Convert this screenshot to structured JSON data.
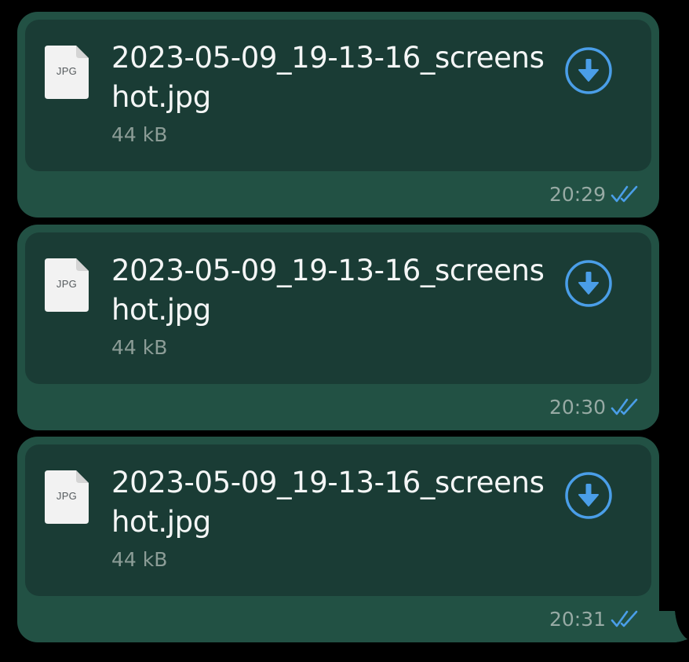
{
  "colors": {
    "bubble": "#225144",
    "card": "#1a3c35",
    "accent": "#4a9ee8",
    "text": "#f4f6f6",
    "muted": "#8c9d97"
  },
  "messages": [
    {
      "file_ext": "JPG",
      "file_name": "2023-05-09_19-13-16_screenshot.jpg",
      "file_size": "44 kB",
      "time": "20:29",
      "status_icon": "double-check-icon",
      "action_icon": "download-icon"
    },
    {
      "file_ext": "JPG",
      "file_name": "2023-05-09_19-13-16_screenshot.jpg",
      "file_size": "44 kB",
      "time": "20:30",
      "status_icon": "double-check-icon",
      "action_icon": "download-icon"
    },
    {
      "file_ext": "JPG",
      "file_name": "2023-05-09_19-13-16_screenshot.jpg",
      "file_size": "44 kB",
      "time": "20:31",
      "status_icon": "double-check-icon",
      "action_icon": "download-icon"
    }
  ]
}
